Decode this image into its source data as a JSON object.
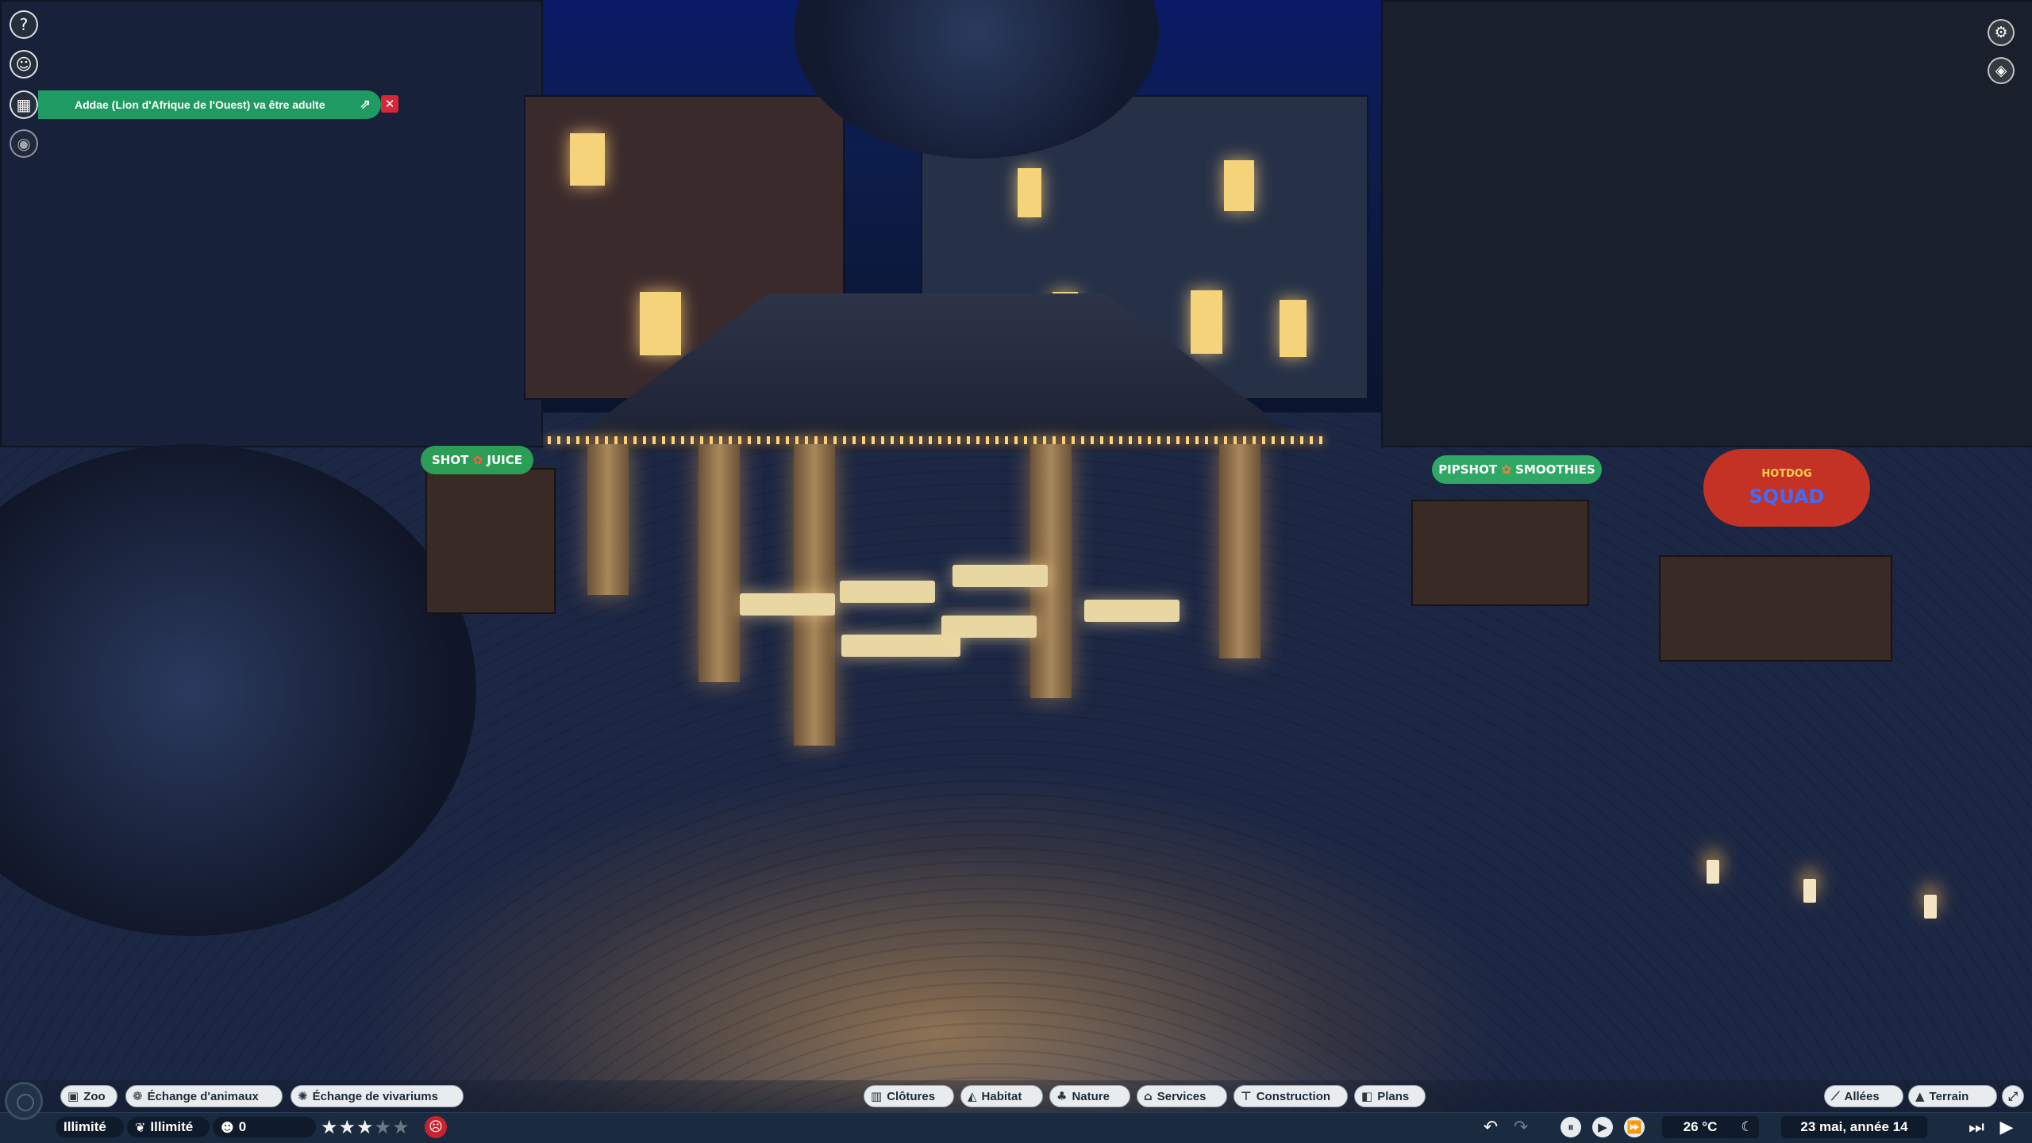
{
  "left_icons": {
    "help": "help-icon",
    "zoopedia": "zoopedia-icon",
    "calendar": "calendar-icon",
    "view": "eye-icon"
  },
  "notification": {
    "text": "Addae (Lion d'Afrique de l'Ouest) va être adulte",
    "open_icon": "external-link-icon",
    "close_icon": "close-icon",
    "color": "#1e9a62",
    "close_color": "#d62638"
  },
  "top_right": {
    "settings": "gear-icon",
    "camera": "camera-icon"
  },
  "toolbar_left": [
    {
      "label": "Zoo",
      "icon": "zoo-icon"
    },
    {
      "label": "Échange d'animaux",
      "icon": "paw-icon"
    },
    {
      "label": "Échange de vivariums",
      "icon": "bug-icon"
    }
  ],
  "toolbar_center": [
    {
      "label": "Clôtures",
      "icon": "fence-icon"
    },
    {
      "label": "Habitat",
      "icon": "habitat-icon"
    },
    {
      "label": "Nature",
      "icon": "tree-icon"
    },
    {
      "label": "Services",
      "icon": "shop-icon"
    },
    {
      "label": "Construction",
      "icon": "construction-icon"
    },
    {
      "label": "Plans",
      "icon": "blueprint-icon"
    }
  ],
  "toolbar_right": [
    {
      "label": "Allées",
      "icon": "path-icon"
    },
    {
      "label": "Terrain",
      "icon": "terrain-icon"
    }
  ],
  "status": {
    "money": "Illimité",
    "research": "Illimité",
    "guests": "0",
    "rating_stars": 3,
    "rating_max": 5,
    "mood_icon": "sad-face-icon",
    "temperature": "26 °C",
    "weather_icon": "moon-icon",
    "date": "23 mai, année 14"
  },
  "scene_signs": {
    "juice_left": "SHOT",
    "juice_right": "JUICE",
    "smoothie_left": "PIPSHOT",
    "smoothie_right": "SMOOTHIES",
    "hotdog_top": "HOTDOG",
    "hotdog_bottom": "SQUAD"
  }
}
